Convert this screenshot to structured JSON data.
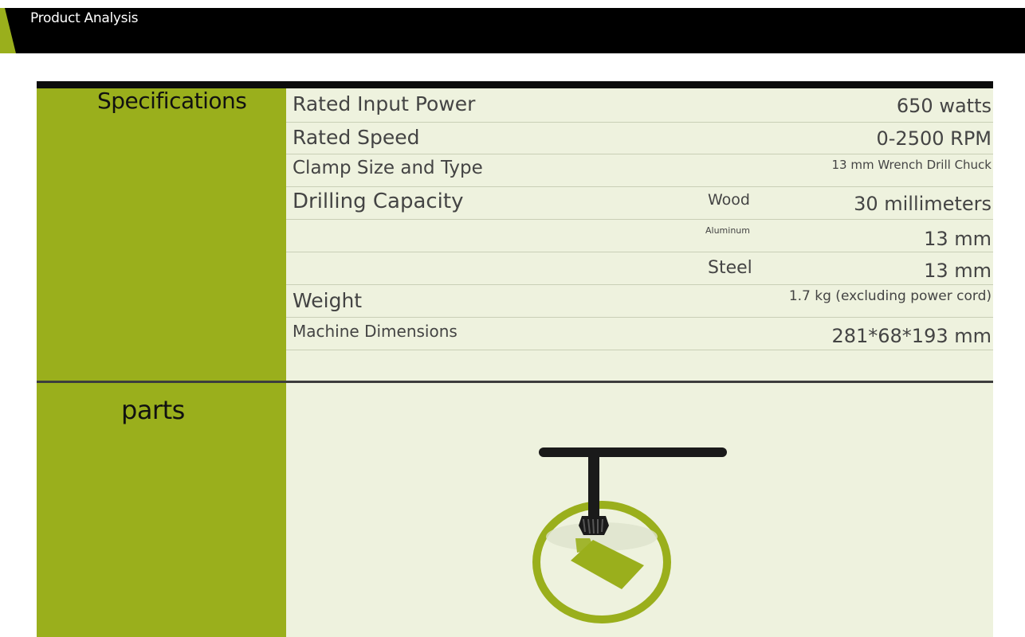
{
  "header": {
    "title": "Product Analysis"
  },
  "specifications": {
    "heading": "Specifications",
    "rows": [
      {
        "label": "Rated Input Power",
        "sub": "",
        "value": "650 watts"
      },
      {
        "label": "Rated Speed",
        "sub": "",
        "value": "0-2500 RPM"
      },
      {
        "label": "Clamp Size and Type",
        "sub": "",
        "value": "13 mm Wrench Drill Chuck"
      },
      {
        "label": "Drilling Capacity",
        "sub": "Wood",
        "value": "30 millimeters"
      },
      {
        "label": "",
        "sub": "Aluminum",
        "value": "13 mm"
      },
      {
        "label": "",
        "sub": "Steel",
        "value": "13 mm"
      },
      {
        "label": "Weight",
        "sub": "",
        "value": "1.7 kg (excluding power cord)"
      },
      {
        "label": "Machine Dimensions",
        "sub": "",
        "value": "281*68*193 mm"
      }
    ]
  },
  "parts": {
    "heading": "parts",
    "image_icon": "chuck-key-icon",
    "colors": {
      "accent": "#9aaf1c",
      "panel": "#eef2de",
      "key": "#1a1a1a"
    }
  }
}
